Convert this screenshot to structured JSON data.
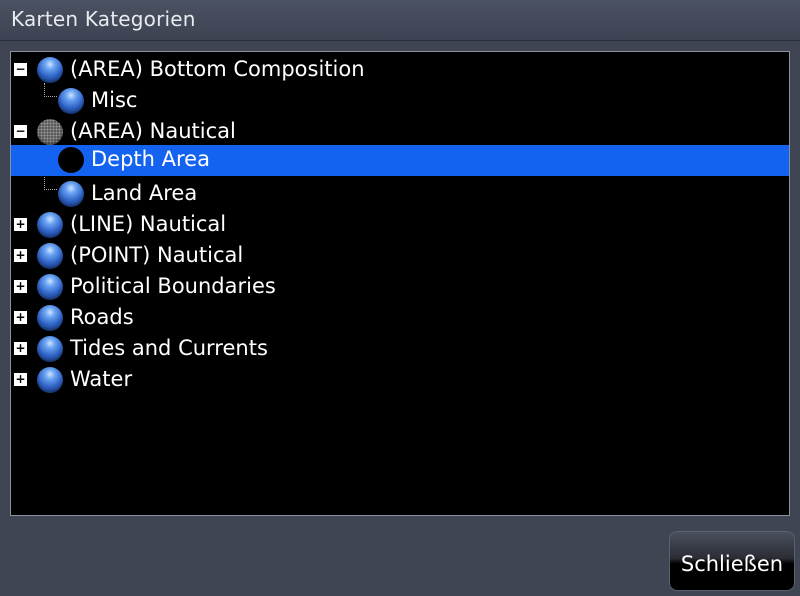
{
  "window": {
    "title": "Karten Kategorien"
  },
  "tree": {
    "items": [
      {
        "label": "(AREA) Bottom Composition",
        "level": 0,
        "expander": "−",
        "icon": "globe-icon"
      },
      {
        "label": "Misc",
        "level": 1,
        "expander": "",
        "icon": "globe-icon"
      },
      {
        "label": "(AREA) Nautical",
        "level": 0,
        "expander": "−",
        "icon": "partial-globe-icon"
      },
      {
        "label": "Depth Area",
        "level": 1,
        "expander": "",
        "icon": "unchecked-globe-icon",
        "selected": true
      },
      {
        "label": "Land Area",
        "level": 1,
        "expander": "",
        "icon": "globe-icon"
      },
      {
        "label": "(LINE) Nautical",
        "level": 0,
        "expander": "+",
        "icon": "globe-icon"
      },
      {
        "label": "(POINT) Nautical",
        "level": 0,
        "expander": "+",
        "icon": "globe-icon"
      },
      {
        "label": "Political Boundaries",
        "level": 0,
        "expander": "+",
        "icon": "globe-icon"
      },
      {
        "label": "Roads",
        "level": 0,
        "expander": "+",
        "icon": "globe-icon"
      },
      {
        "label": "Tides and Currents",
        "level": 0,
        "expander": "+",
        "icon": "globe-icon"
      },
      {
        "label": "Water",
        "level": 0,
        "expander": "+",
        "icon": "globe-icon"
      }
    ]
  },
  "footer": {
    "close_label": "Schließen"
  },
  "colors": {
    "selection": "#1463f0",
    "background": "#3f4553",
    "panel": "#000000"
  }
}
